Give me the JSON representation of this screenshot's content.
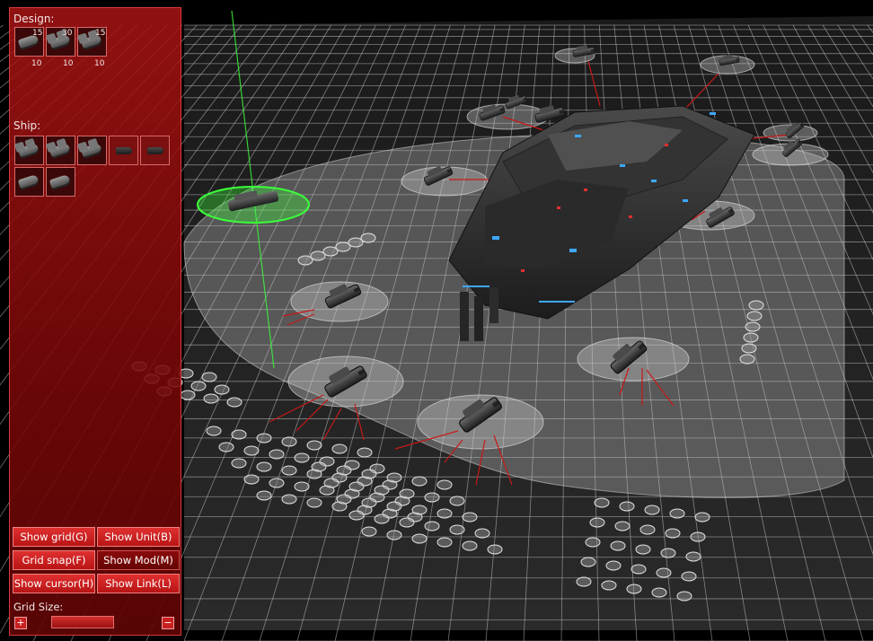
{
  "panel": {
    "design_label": "Design:",
    "design_items": [
      {
        "icon": "cruiser-ship-icon",
        "top_count": "15",
        "bottom_count": "10"
      },
      {
        "icon": "squadron-ship-icon",
        "top_count": "30",
        "bottom_count": "10"
      },
      {
        "icon": "carrier-ship-icon",
        "top_count": "15",
        "bottom_count": "10"
      }
    ],
    "ship_label": "Ship:",
    "ship_items": [
      {
        "icon": "squadron-ship-icon"
      },
      {
        "icon": "squadron-ship-icon"
      },
      {
        "icon": "squadron-ship-icon"
      },
      {
        "icon": "fighter-ship-icon"
      },
      {
        "icon": "fighter-ship-icon"
      },
      {
        "icon": "frigate-ship-icon"
      },
      {
        "icon": "frigate-ship-icon"
      }
    ],
    "buttons": {
      "show_grid": "Show grid(G)",
      "show_unit": "Show Unit(B)",
      "grid_snap": "Grid snap(F)",
      "show_mod": "Show Mod(M)",
      "show_cursor": "Show cursor(H)",
      "show_link": "Show Link(L)"
    },
    "grid_size_label": "Grid Size:",
    "grid_plus": "+",
    "grid_minus": "−"
  },
  "colors": {
    "panel_red": "#b81414",
    "button_red": "#e03030",
    "grid_line": "#d8d8d8",
    "link_line": "#c81818",
    "selection_green": "#3cff3c"
  }
}
